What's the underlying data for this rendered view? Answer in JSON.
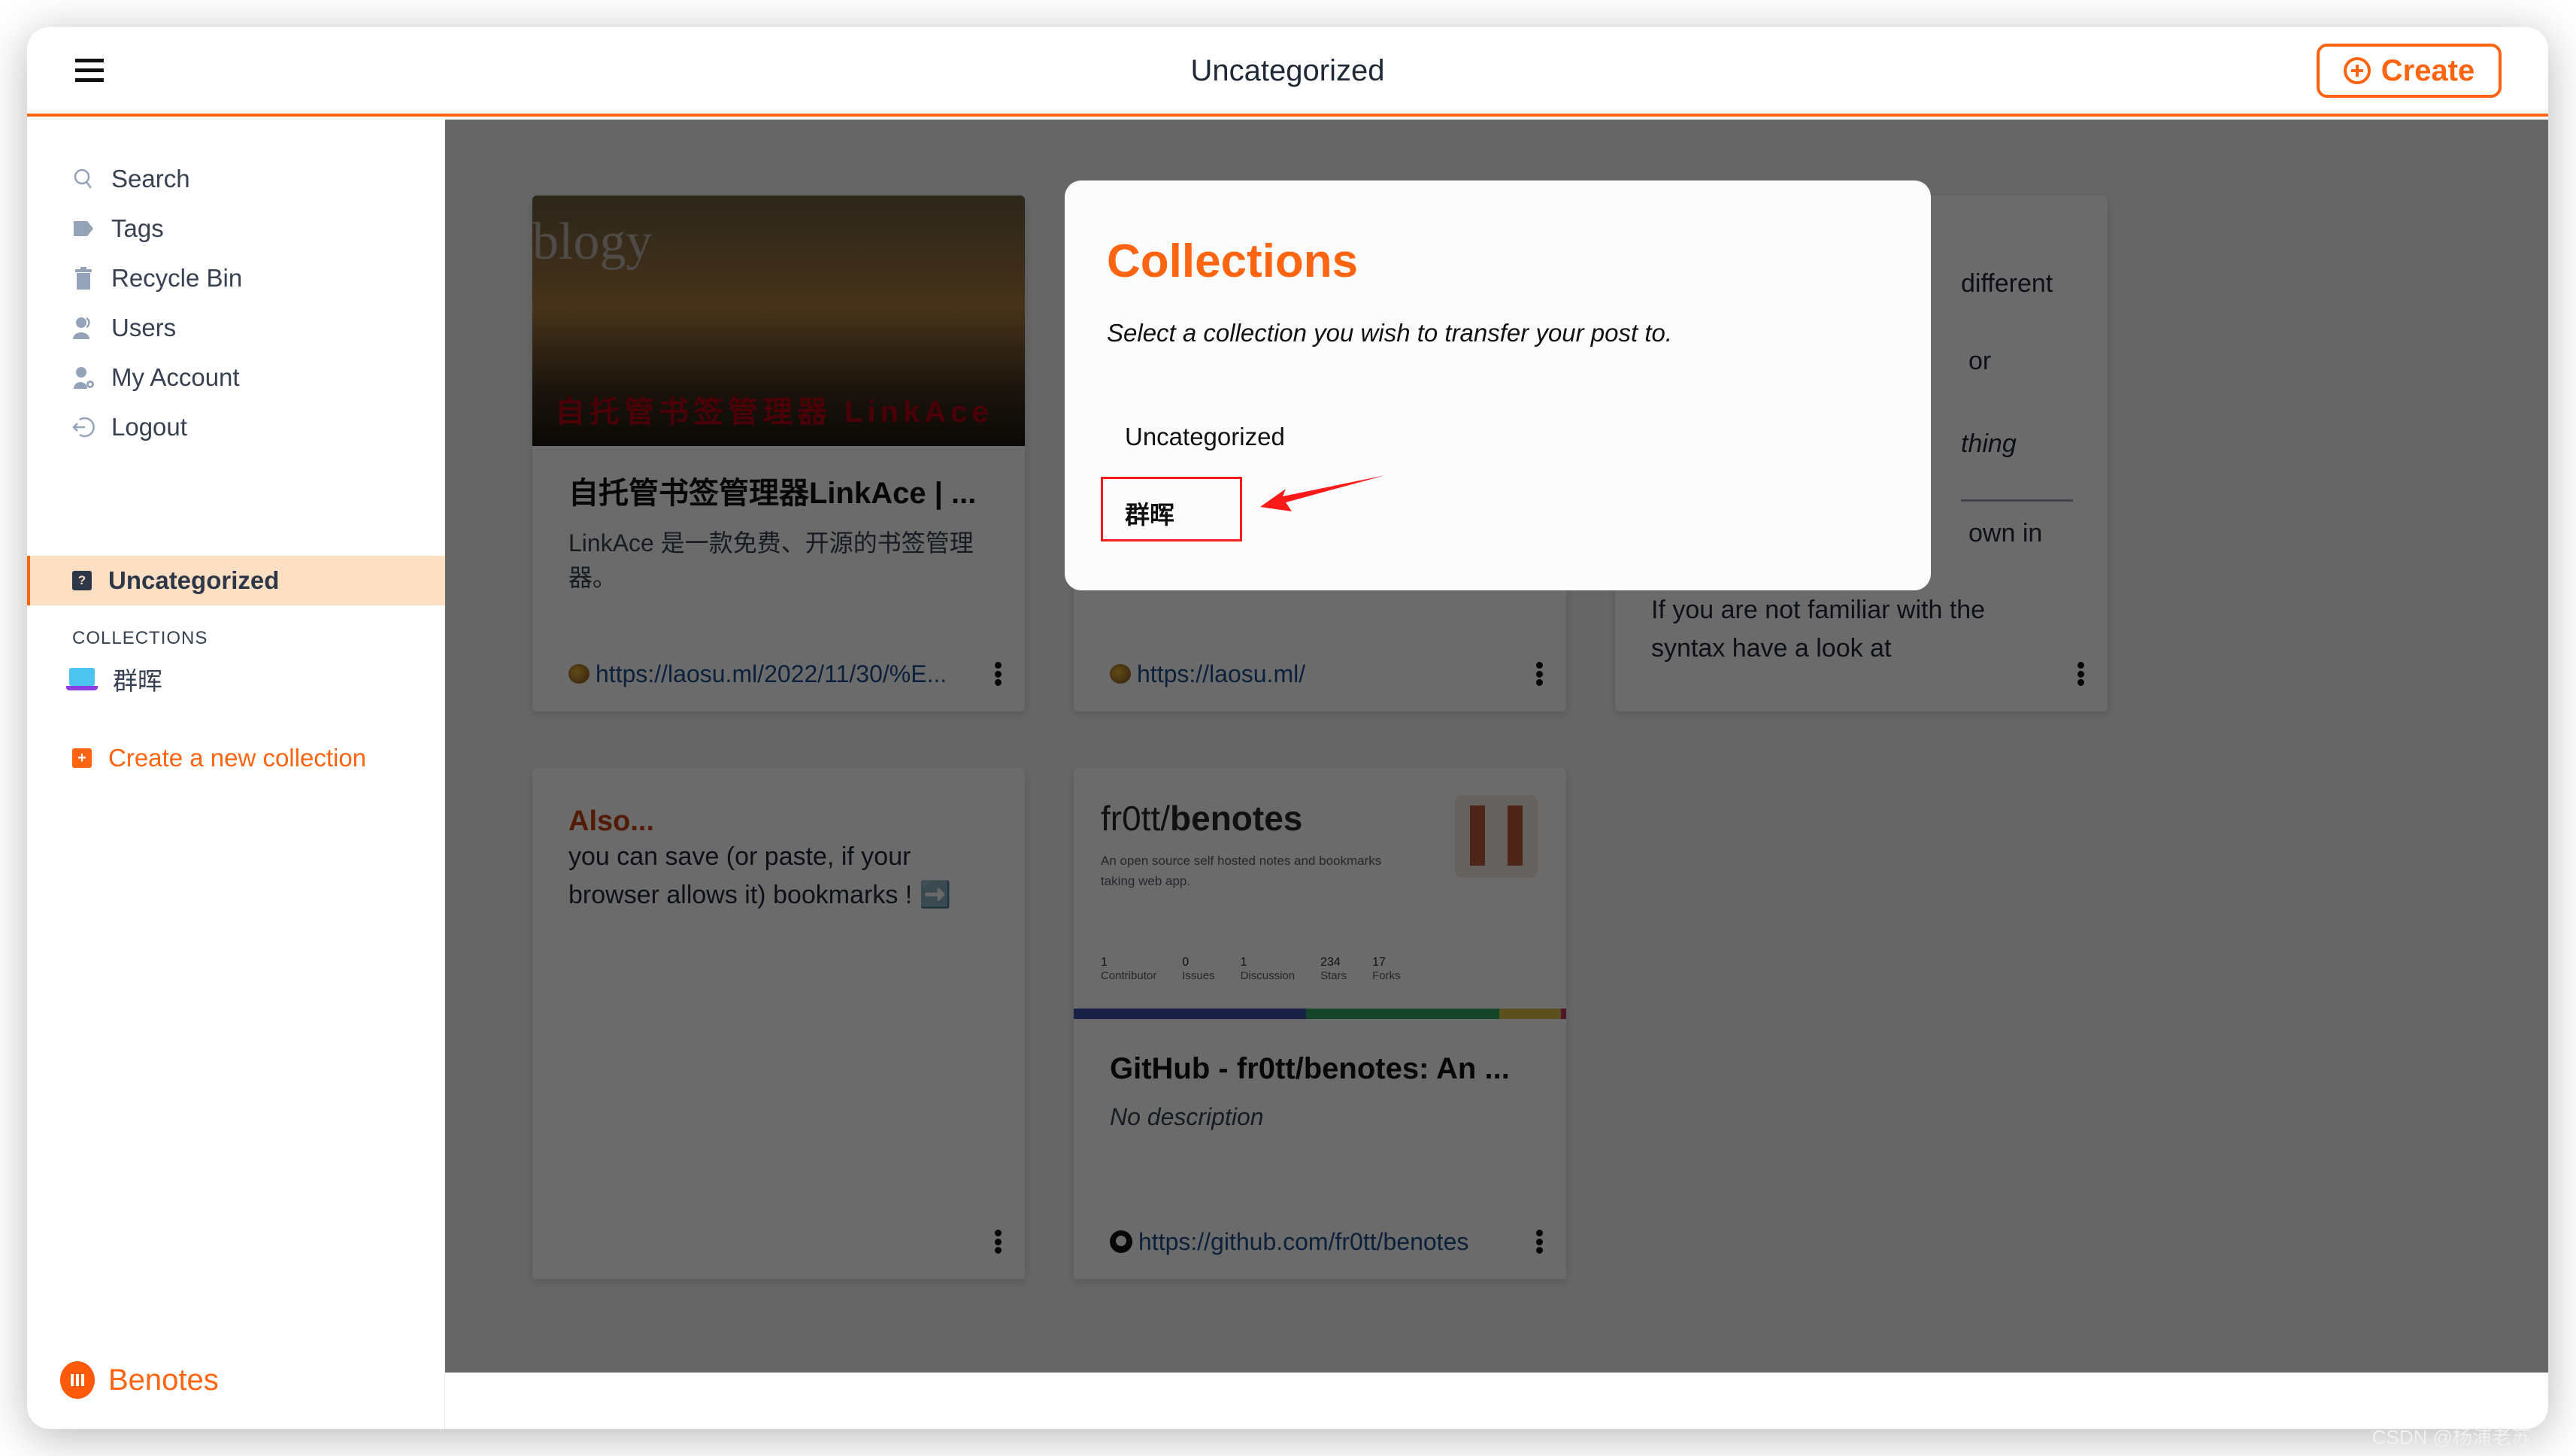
{
  "header": {
    "title": "Uncategorized",
    "create_label": "Create"
  },
  "sidebar": {
    "nav": [
      {
        "label": "Search",
        "icon": "search-icon"
      },
      {
        "label": "Tags",
        "icon": "tag-icon"
      },
      {
        "label": "Recycle Bin",
        "icon": "trash-icon"
      },
      {
        "label": "Users",
        "icon": "users-icon"
      },
      {
        "label": "My Account",
        "icon": "user-cog-icon"
      },
      {
        "label": "Logout",
        "icon": "logout-icon"
      }
    ],
    "active_item": {
      "label": "Uncategorized",
      "icon": "folder-question-icon"
    },
    "collections_heading": "COLLECTIONS",
    "collections": [
      {
        "label": "群晖",
        "icon": "laptop-icon"
      }
    ],
    "create_collection_label": "Create a new collection",
    "brand": "Benotes"
  },
  "cards": [
    {
      "image_caption": "自托管书签管理器 LinkAce",
      "image_watermark": "blogy",
      "title": "自托管书签管理器LinkAce | ...",
      "description": "LinkAce 是一款免费、开源的书签管理器。",
      "url": "https://laosu.ml/2022/11/30/%E..."
    },
    {
      "title": "",
      "description": "",
      "url": "https://laosu.ml/"
    },
    {
      "text_fragments": [
        "different",
        "or",
        "thing",
        "own in"
      ],
      "text_tail": "If you are not familiar with the syntax have a look at"
    },
    {
      "heading": "Also...",
      "text": "you can save (or paste, if your browser allows it) bookmarks ! ➡️"
    },
    {
      "preview": {
        "repo_owner": "fr0tt/",
        "repo_name": "benotes",
        "repo_desc": "An open source self hosted notes and bookmarks taking web app.",
        "stats": [
          {
            "num": "1",
            "label": "Contributor"
          },
          {
            "num": "0",
            "label": "Issues"
          },
          {
            "num": "1",
            "label": "Discussion"
          },
          {
            "num": "234",
            "label": "Stars"
          },
          {
            "num": "17",
            "label": "Forks"
          }
        ]
      },
      "title": "GitHub - fr0tt/benotes: An ...",
      "description": "No description",
      "url": "https://github.com/fr0tt/benotes"
    }
  ],
  "modal": {
    "title": "Collections",
    "subtitle": "Select a collection you wish to transfer your post to.",
    "options": [
      "Uncategorized",
      "群晖"
    ],
    "highlighted_option": "群晖"
  },
  "colors": {
    "accent": "#ff6410",
    "link": "#1e4e8c",
    "annotation_red": "#ff1a1a"
  },
  "watermark": "CSDN @杨浦老苏"
}
